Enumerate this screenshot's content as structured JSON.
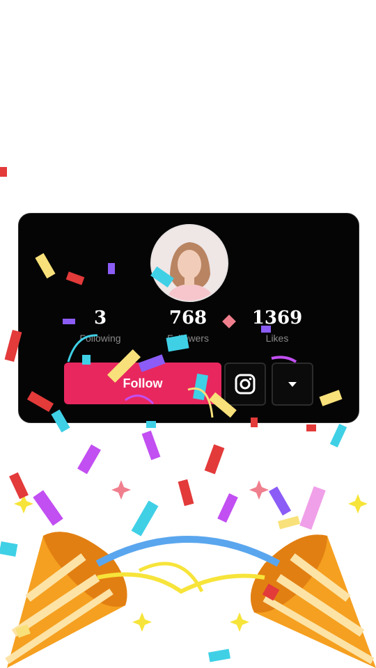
{
  "profile": {
    "avatar_alt": "profile photo",
    "stats": [
      {
        "value": "3",
        "label": "Following"
      },
      {
        "value": "768",
        "label": "Followers"
      },
      {
        "value": "1369",
        "label": "Likes"
      }
    ],
    "follow_label": "Follow",
    "instagram_icon": "instagram-icon",
    "more_icon": "chevron-down-icon"
  },
  "colors": {
    "card_background": "#050505",
    "follow_button": "#e8275f",
    "popper": "#f5a020"
  }
}
